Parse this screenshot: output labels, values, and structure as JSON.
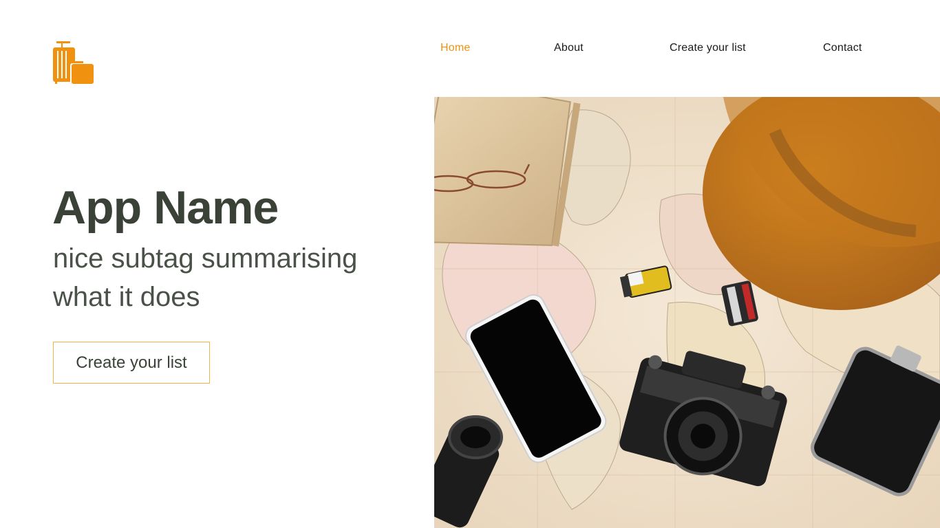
{
  "logo": {
    "icon": "luggage-icon",
    "color": "#f0920f"
  },
  "nav": {
    "items": [
      {
        "label": "Home",
        "active": true
      },
      {
        "label": "About",
        "active": false
      },
      {
        "label": "Create your list",
        "active": false
      },
      {
        "label": "Contact",
        "active": false
      }
    ]
  },
  "hero": {
    "title": "App Name",
    "subtitle": "nice subtag summarising what it does",
    "cta_label": "Create your list"
  },
  "image": {
    "icon": "travel-flatlay-image"
  },
  "colors": {
    "accent": "#f0920f",
    "text": "#3a4137",
    "cta_border": "#f3b24a"
  }
}
